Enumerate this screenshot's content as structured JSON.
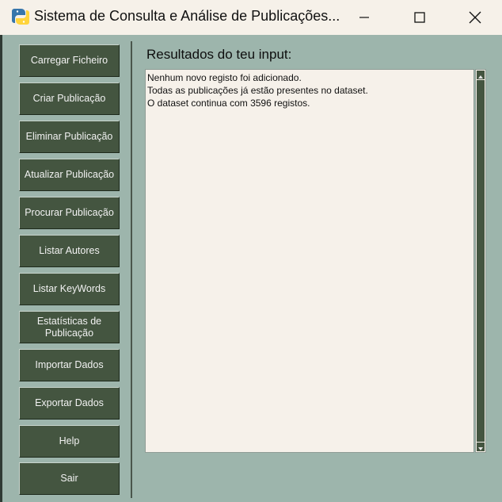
{
  "window": {
    "title": "Sistema de Consulta e Análise de Publicações...",
    "icon": "python-icon",
    "controls": [
      "minimize-icon",
      "maximize-icon",
      "close-icon"
    ]
  },
  "sidebar": {
    "items": [
      {
        "label": "Carregar Ficheiro"
      },
      {
        "label": "Criar Publicação"
      },
      {
        "label": "Eliminar Publicação"
      },
      {
        "label": "Atualizar Publicação"
      },
      {
        "label": "Procurar Publicação"
      },
      {
        "label": "Listar Autores"
      },
      {
        "label": "Listar KeyWords"
      },
      {
        "label": "Estatísticas de Publicação"
      },
      {
        "label": "Importar Dados"
      },
      {
        "label": "Exportar Dados"
      },
      {
        "label": "Help"
      },
      {
        "label": "Sair"
      }
    ]
  },
  "main": {
    "heading": "Resultados do teu input:",
    "output_lines": [
      "Nenhum novo registo foi adicionado.",
      "Todas as publicações já estão presentes no dataset.",
      "O dataset continua com 3596 registos."
    ]
  },
  "colors": {
    "background": "#9db5ac",
    "button": "#445540",
    "titlebar": "#f6f1e9",
    "output_bg": "#f6f1ea"
  }
}
